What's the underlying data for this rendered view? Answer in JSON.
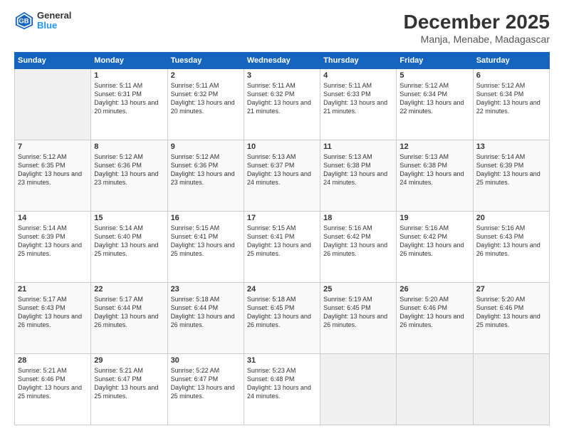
{
  "logo": {
    "line1": "General",
    "line2": "Blue"
  },
  "title": "December 2025",
  "subtitle": "Manja, Menabe, Madagascar",
  "days_of_week": [
    "Sunday",
    "Monday",
    "Tuesday",
    "Wednesday",
    "Thursday",
    "Friday",
    "Saturday"
  ],
  "weeks": [
    [
      {
        "day": "",
        "sunrise": "",
        "sunset": "",
        "daylight": ""
      },
      {
        "day": "1",
        "sunrise": "Sunrise: 5:11 AM",
        "sunset": "Sunset: 6:31 PM",
        "daylight": "Daylight: 13 hours and 20 minutes."
      },
      {
        "day": "2",
        "sunrise": "Sunrise: 5:11 AM",
        "sunset": "Sunset: 6:32 PM",
        "daylight": "Daylight: 13 hours and 20 minutes."
      },
      {
        "day": "3",
        "sunrise": "Sunrise: 5:11 AM",
        "sunset": "Sunset: 6:32 PM",
        "daylight": "Daylight: 13 hours and 21 minutes."
      },
      {
        "day": "4",
        "sunrise": "Sunrise: 5:11 AM",
        "sunset": "Sunset: 6:33 PM",
        "daylight": "Daylight: 13 hours and 21 minutes."
      },
      {
        "day": "5",
        "sunrise": "Sunrise: 5:12 AM",
        "sunset": "Sunset: 6:34 PM",
        "daylight": "Daylight: 13 hours and 22 minutes."
      },
      {
        "day": "6",
        "sunrise": "Sunrise: 5:12 AM",
        "sunset": "Sunset: 6:34 PM",
        "daylight": "Daylight: 13 hours and 22 minutes."
      }
    ],
    [
      {
        "day": "7",
        "sunrise": "Sunrise: 5:12 AM",
        "sunset": "Sunset: 6:35 PM",
        "daylight": "Daylight: 13 hours and 23 minutes."
      },
      {
        "day": "8",
        "sunrise": "Sunrise: 5:12 AM",
        "sunset": "Sunset: 6:36 PM",
        "daylight": "Daylight: 13 hours and 23 minutes."
      },
      {
        "day": "9",
        "sunrise": "Sunrise: 5:12 AM",
        "sunset": "Sunset: 6:36 PM",
        "daylight": "Daylight: 13 hours and 23 minutes."
      },
      {
        "day": "10",
        "sunrise": "Sunrise: 5:13 AM",
        "sunset": "Sunset: 6:37 PM",
        "daylight": "Daylight: 13 hours and 24 minutes."
      },
      {
        "day": "11",
        "sunrise": "Sunrise: 5:13 AM",
        "sunset": "Sunset: 6:38 PM",
        "daylight": "Daylight: 13 hours and 24 minutes."
      },
      {
        "day": "12",
        "sunrise": "Sunrise: 5:13 AM",
        "sunset": "Sunset: 6:38 PM",
        "daylight": "Daylight: 13 hours and 24 minutes."
      },
      {
        "day": "13",
        "sunrise": "Sunrise: 5:14 AM",
        "sunset": "Sunset: 6:39 PM",
        "daylight": "Daylight: 13 hours and 25 minutes."
      }
    ],
    [
      {
        "day": "14",
        "sunrise": "Sunrise: 5:14 AM",
        "sunset": "Sunset: 6:39 PM",
        "daylight": "Daylight: 13 hours and 25 minutes."
      },
      {
        "day": "15",
        "sunrise": "Sunrise: 5:14 AM",
        "sunset": "Sunset: 6:40 PM",
        "daylight": "Daylight: 13 hours and 25 minutes."
      },
      {
        "day": "16",
        "sunrise": "Sunrise: 5:15 AM",
        "sunset": "Sunset: 6:41 PM",
        "daylight": "Daylight: 13 hours and 25 minutes."
      },
      {
        "day": "17",
        "sunrise": "Sunrise: 5:15 AM",
        "sunset": "Sunset: 6:41 PM",
        "daylight": "Daylight: 13 hours and 25 minutes."
      },
      {
        "day": "18",
        "sunrise": "Sunrise: 5:16 AM",
        "sunset": "Sunset: 6:42 PM",
        "daylight": "Daylight: 13 hours and 26 minutes."
      },
      {
        "day": "19",
        "sunrise": "Sunrise: 5:16 AM",
        "sunset": "Sunset: 6:42 PM",
        "daylight": "Daylight: 13 hours and 26 minutes."
      },
      {
        "day": "20",
        "sunrise": "Sunrise: 5:16 AM",
        "sunset": "Sunset: 6:43 PM",
        "daylight": "Daylight: 13 hours and 26 minutes."
      }
    ],
    [
      {
        "day": "21",
        "sunrise": "Sunrise: 5:17 AM",
        "sunset": "Sunset: 6:43 PM",
        "daylight": "Daylight: 13 hours and 26 minutes."
      },
      {
        "day": "22",
        "sunrise": "Sunrise: 5:17 AM",
        "sunset": "Sunset: 6:44 PM",
        "daylight": "Daylight: 13 hours and 26 minutes."
      },
      {
        "day": "23",
        "sunrise": "Sunrise: 5:18 AM",
        "sunset": "Sunset: 6:44 PM",
        "daylight": "Daylight: 13 hours and 26 minutes."
      },
      {
        "day": "24",
        "sunrise": "Sunrise: 5:18 AM",
        "sunset": "Sunset: 6:45 PM",
        "daylight": "Daylight: 13 hours and 26 minutes."
      },
      {
        "day": "25",
        "sunrise": "Sunrise: 5:19 AM",
        "sunset": "Sunset: 6:45 PM",
        "daylight": "Daylight: 13 hours and 26 minutes."
      },
      {
        "day": "26",
        "sunrise": "Sunrise: 5:20 AM",
        "sunset": "Sunset: 6:46 PM",
        "daylight": "Daylight: 13 hours and 26 minutes."
      },
      {
        "day": "27",
        "sunrise": "Sunrise: 5:20 AM",
        "sunset": "Sunset: 6:46 PM",
        "daylight": "Daylight: 13 hours and 25 minutes."
      }
    ],
    [
      {
        "day": "28",
        "sunrise": "Sunrise: 5:21 AM",
        "sunset": "Sunset: 6:46 PM",
        "daylight": "Daylight: 13 hours and 25 minutes."
      },
      {
        "day": "29",
        "sunrise": "Sunrise: 5:21 AM",
        "sunset": "Sunset: 6:47 PM",
        "daylight": "Daylight: 13 hours and 25 minutes."
      },
      {
        "day": "30",
        "sunrise": "Sunrise: 5:22 AM",
        "sunset": "Sunset: 6:47 PM",
        "daylight": "Daylight: 13 hours and 25 minutes."
      },
      {
        "day": "31",
        "sunrise": "Sunrise: 5:23 AM",
        "sunset": "Sunset: 6:48 PM",
        "daylight": "Daylight: 13 hours and 24 minutes."
      },
      {
        "day": "",
        "sunrise": "",
        "sunset": "",
        "daylight": ""
      },
      {
        "day": "",
        "sunrise": "",
        "sunset": "",
        "daylight": ""
      },
      {
        "day": "",
        "sunrise": "",
        "sunset": "",
        "daylight": ""
      }
    ]
  ]
}
